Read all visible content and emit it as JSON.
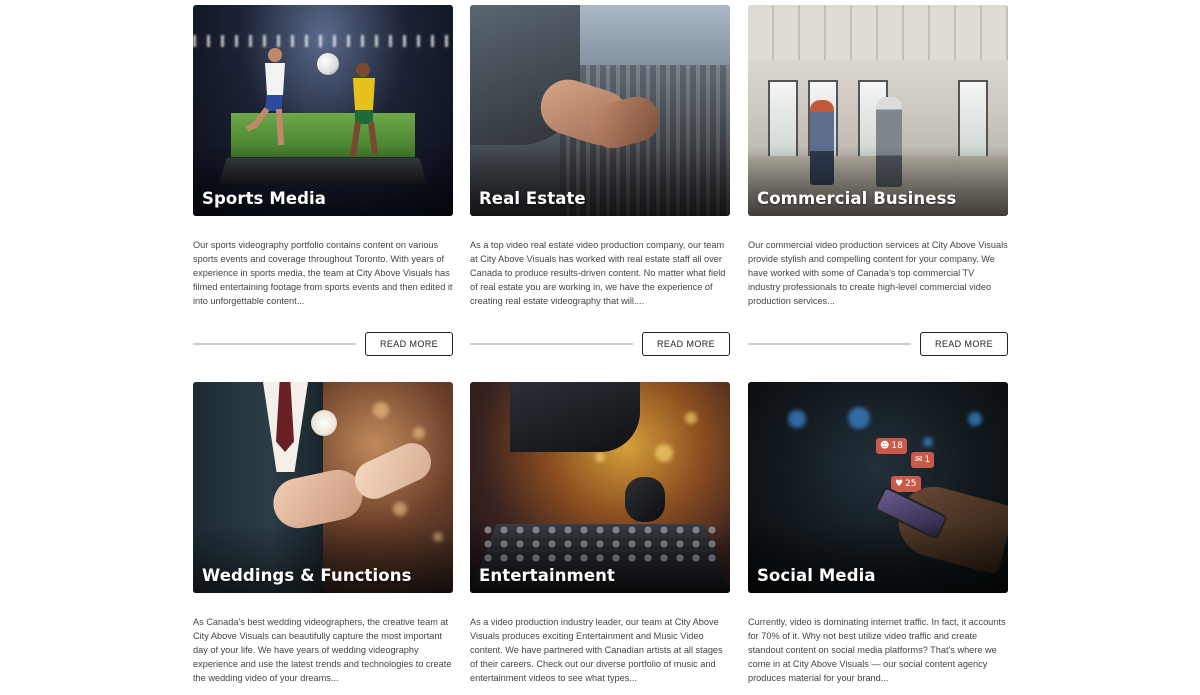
{
  "read_more_label": "READ MORE",
  "cards": [
    {
      "title": "Sports Media",
      "description": "Our sports videography portfolio contains content on various sports events and coverage throughout Toronto. With years of experience in sports media, the team at City Above Visuals has filmed entertaining footage from sports events and then edited it into unforgettable content..."
    },
    {
      "title": "Real Estate",
      "description": "As a top video real estate video production company, our team at City Above Visuals has worked with real estate staff all over Canada to produce results-driven content. No matter what field of real estate you are working in, we have the experience of creating real estate videography that will...."
    },
    {
      "title": "Commercial Business",
      "description": "Our commercial video production services at City Above Visuals provide stylish and compelling content for your company. We have worked with some of Canada's top commercial TV industry professionals to create high-level commercial video production services..."
    },
    {
      "title": "Weddings & Functions",
      "description": "As Canada's best wedding videographers, the creative team at City Above Visuals can beautifully capture the most important day of your life. We have years of wedding videography experience and use the latest trends and technologies to create the wedding video of your dreams..."
    },
    {
      "title": "Entertainment",
      "description": "As a video production industry leader, our team at City Above Visuals produces exciting Entertainment and Music Video content. We have partnered with Canadian artists at all stages of their careers. Check out our diverse portfolio of music and entertainment videos to see what types..."
    },
    {
      "title": "Social Media",
      "description": "Currently, video is dominating internet traffic. In fact, it accounts for 70% of it. Why not best utilize video traffic and create standout content on social media platforms? That's where we come in at City Above Visuals — our social content agency produces material for your brand..."
    }
  ],
  "social_badges": {
    "followers": "18",
    "comments": "1",
    "likes": "25"
  }
}
